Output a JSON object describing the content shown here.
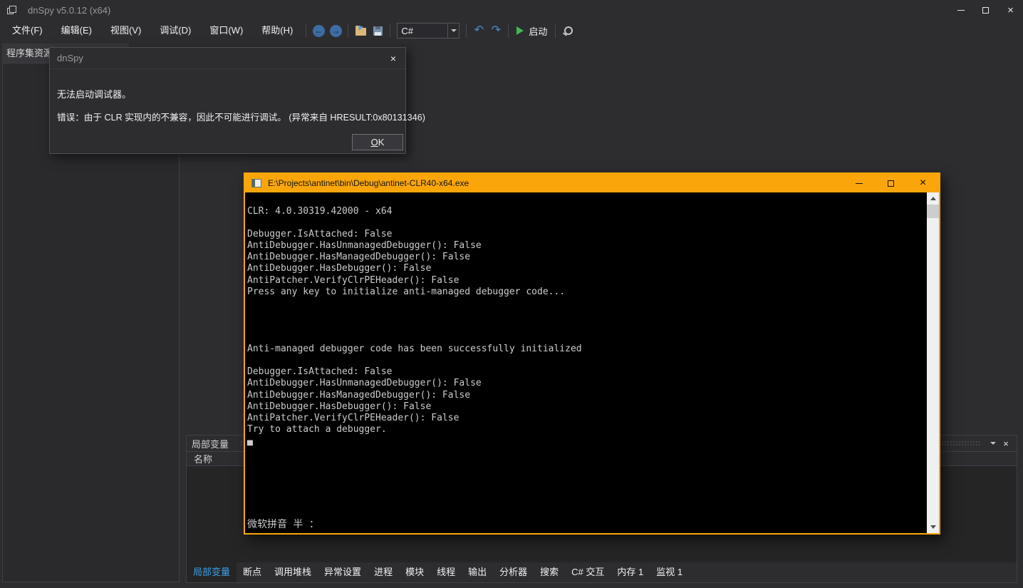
{
  "titlebar": {
    "title": "dnSpy v5.0.12 (x64)"
  },
  "menubar": {
    "items": [
      "文件(F)",
      "编辑(E)",
      "视图(V)",
      "调试(D)",
      "窗口(W)",
      "帮助(H)"
    ]
  },
  "toolbar": {
    "language_value": "C#",
    "start_label": "启动"
  },
  "assembly_explorer": {
    "tab_label": "程序集资源管理器"
  },
  "dialog": {
    "title": "dnSpy",
    "message_line1": "无法启动调试器。",
    "message_line2": "错误：由于 CLR 实现内的不兼容，因此不可能进行调试。 (异常来自 HRESULT:0x80131346)",
    "ok_accel": "O",
    "ok_rest": "K"
  },
  "console": {
    "title": "E:\\Projects\\antinet\\bin\\Debug\\antinet-CLR40-x64.exe",
    "text": "CLR: 4.0.30319.42000 - x64\n\nDebugger.IsAttached: False\nAntiDebugger.HasUnmanagedDebugger(): False\nAntiDebugger.HasManagedDebugger(): False\nAntiDebugger.HasDebugger(): False\nAntiPatcher.VerifyClrPEHeader(): False\nPress any key to initialize anti-managed debugger code...\n\n\n\n\nAnti-managed debugger code has been successfully initialized\n\nDebugger.IsAttached: False\nAntiDebugger.HasUnmanagedDebugger(): False\nAntiDebugger.HasManagedDebugger(): False\nAntiDebugger.HasDebugger(): False\nAntiPatcher.VerifyClrPEHeader(): False\nTry to attach a debugger.\n▄",
    "ime_status": "微软拼音 半 ："
  },
  "locals_panel": {
    "title": "局部变量",
    "name_column": "名称"
  },
  "bottom_tabs": {
    "items": [
      "局部变量",
      "断点",
      "调用堆栈",
      "异常设置",
      "进程",
      "模块",
      "线程",
      "输出",
      "分析器",
      "搜索",
      "C# 交互",
      "内存 1",
      "监视 1"
    ],
    "active": "局部变量"
  },
  "icons": {
    "back_arrow": "←",
    "forward_arrow": "→",
    "undo": "↶",
    "redo": "↷",
    "close": "×"
  },
  "colors": {
    "console_accent": "#faa60a",
    "active_tab_text": "#3ba0e8",
    "start_green": "#3fb950",
    "background": "#2d2d30",
    "console_text": "#cccccc"
  }
}
